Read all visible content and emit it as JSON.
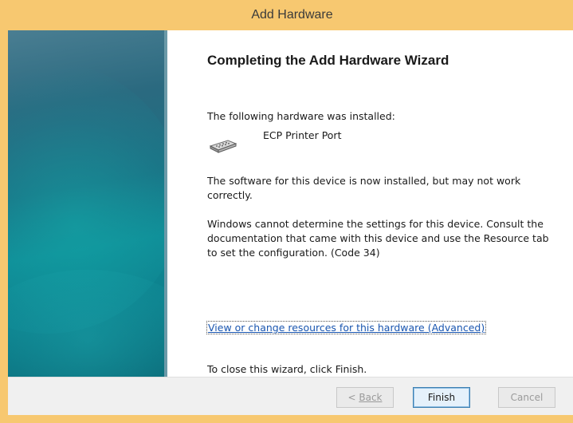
{
  "window": {
    "title": "Add Hardware"
  },
  "wizard": {
    "heading": "Completing the Add Hardware Wizard",
    "installed_label": "The following hardware was installed:",
    "device_name": "ECP Printer Port",
    "device_icon": "printer-port-icon",
    "software_message": "The software for this device is now installed, but may not work correctly.",
    "windows_message": "Windows cannot determine the settings for this device. Consult the documentation that came with this device and use the Resource tab to set the configuration. (Code 34)",
    "advanced_link": "View or change resources for this hardware (Advanced)",
    "close_message": "To close this wizard, click Finish."
  },
  "buttons": {
    "back_prefix": "< ",
    "back_label": "Back",
    "finish_label": "Finish",
    "cancel_label": "Cancel"
  },
  "colors": {
    "title_bar": "#f7c870",
    "banner": "#1b6f82",
    "link": "#1a56b0",
    "button_focus_border": "#3c7fb1"
  }
}
